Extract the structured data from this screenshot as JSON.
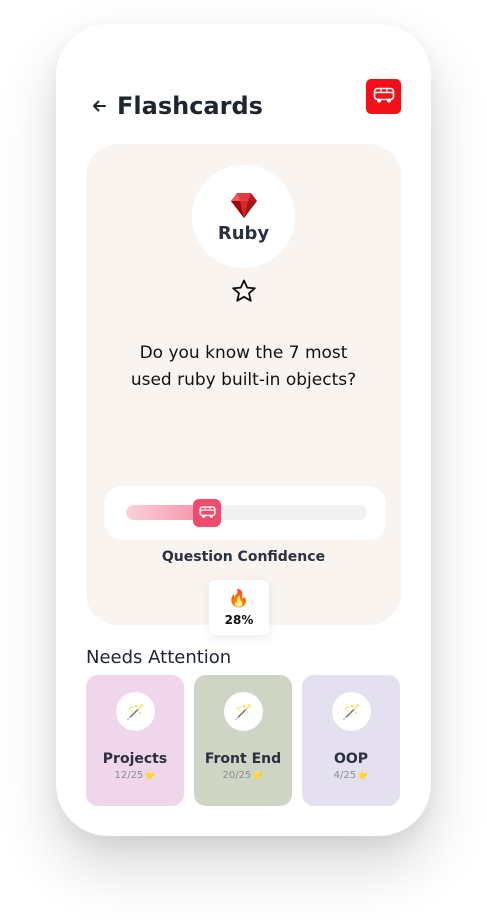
{
  "header": {
    "title": "Flashcards",
    "back_icon": "arrow-left-icon",
    "action_icon": "bus-icon",
    "action_color": "#f0101a"
  },
  "card": {
    "topic": "Ruby",
    "topic_icon": "ruby-gem-icon",
    "favorite_icon": "star-outline-icon",
    "question_line1": "Do you know the 7 most",
    "question_line2": "used ruby built-in objects?",
    "background": "#f9f4f0"
  },
  "confidence": {
    "label": "Question Confidence",
    "value": 0.28,
    "percent_text": "28%",
    "handle_icon": "bus-icon",
    "fire_icon": "🔥",
    "accent": "#ef4c6e"
  },
  "needs_attention": {
    "title": "Needs Attention",
    "items": [
      {
        "name": "Projects",
        "progress": "12/25",
        "color": "#f0d6ea",
        "icon": "🪄"
      },
      {
        "name": "Front End",
        "progress": "20/25",
        "color": "#ced5c5",
        "icon": "🪄"
      },
      {
        "name": "OOP",
        "progress": "4/25",
        "color": "#e4e0f0",
        "icon": "🪄"
      }
    ],
    "star": "⭐"
  }
}
